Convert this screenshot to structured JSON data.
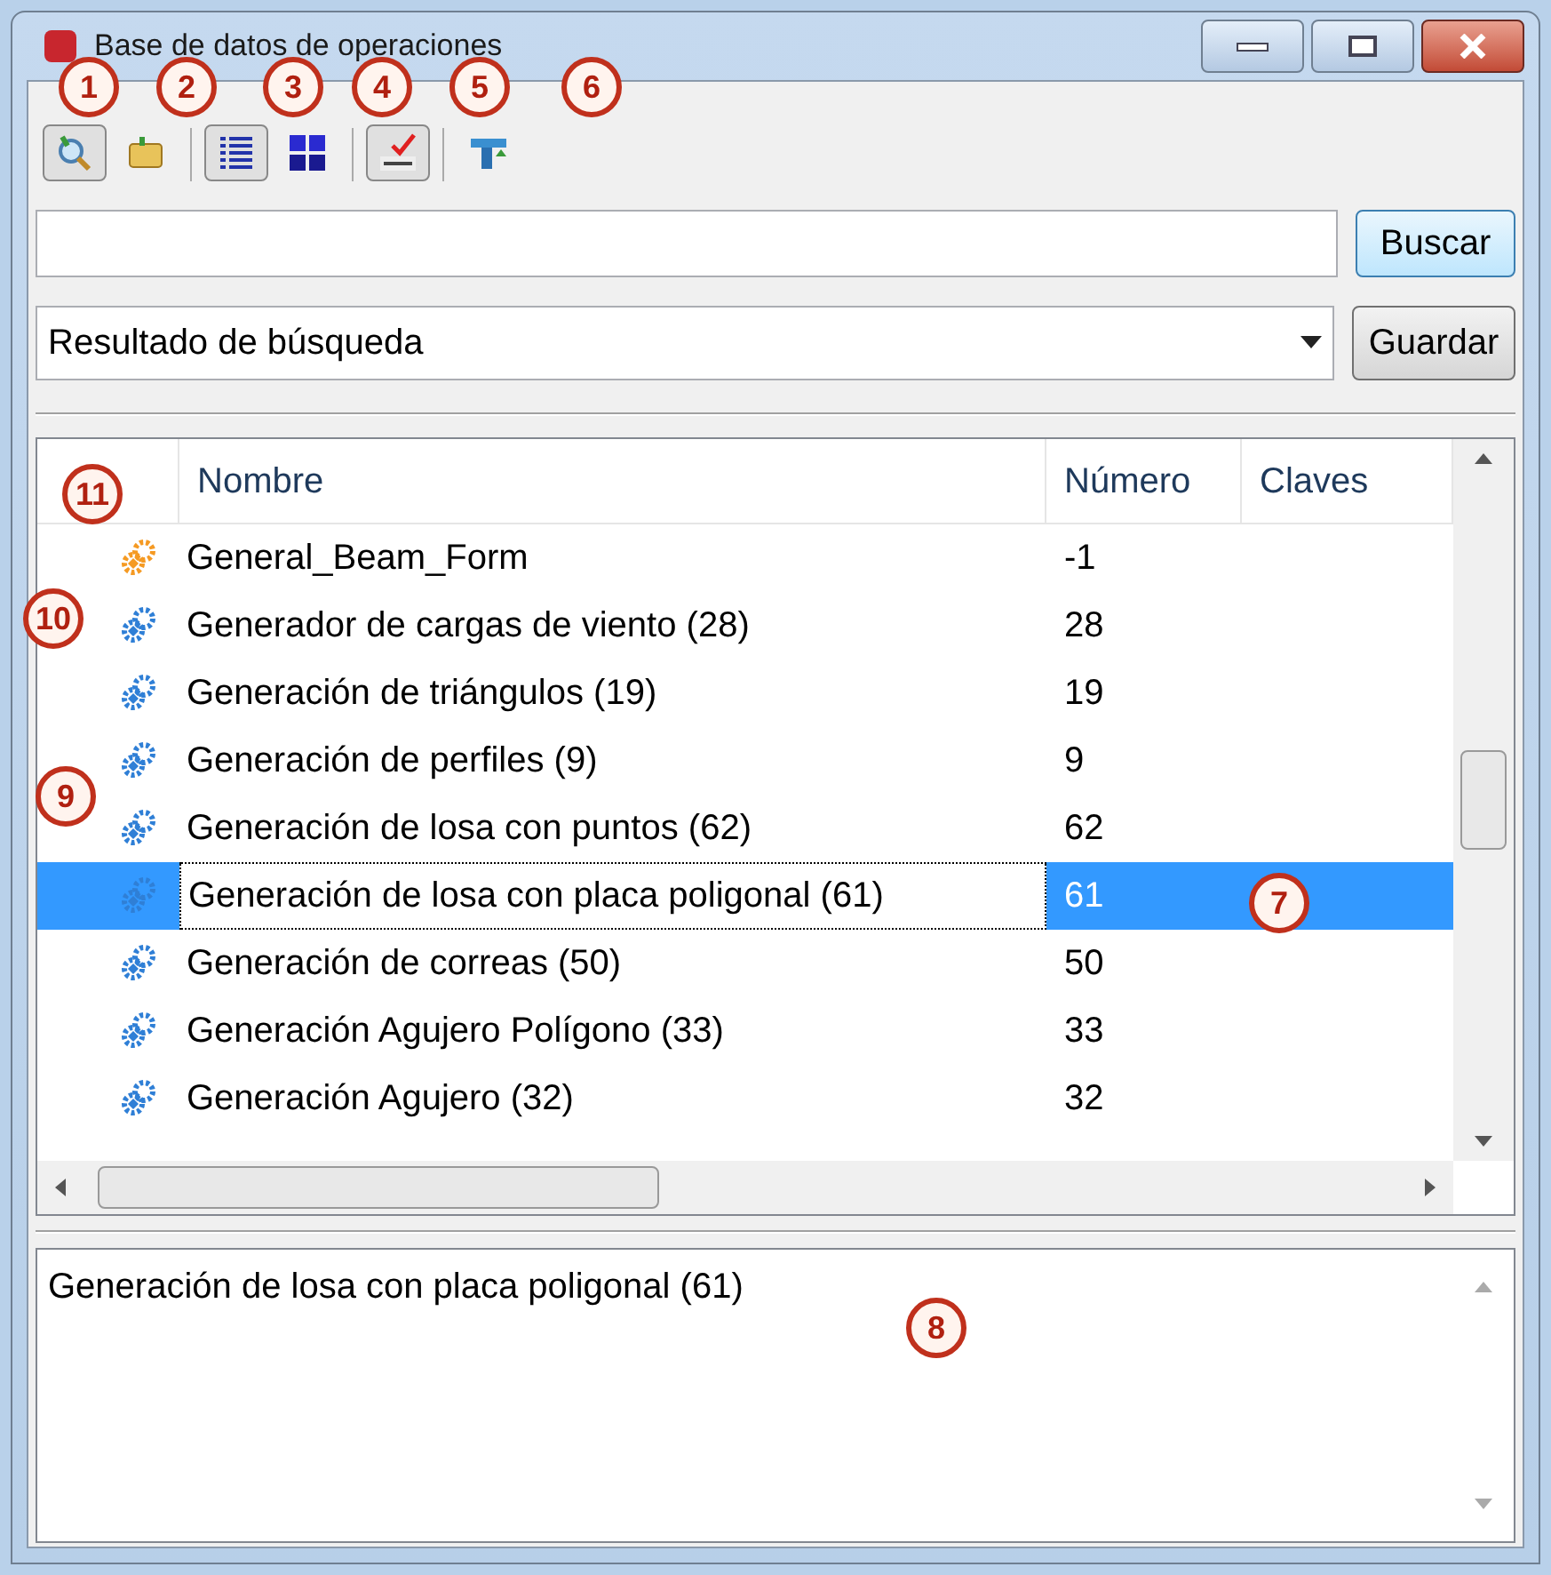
{
  "window": {
    "title": "Base de datos de operaciones"
  },
  "toolbar": [
    {
      "kind": "search",
      "pressed": true
    },
    {
      "kind": "folder",
      "pressed": false
    },
    {
      "kind": "list",
      "pressed": true
    },
    {
      "kind": "tiles",
      "pressed": false
    },
    {
      "kind": "spell",
      "pressed": true
    },
    {
      "kind": "filter",
      "pressed": false
    }
  ],
  "search": {
    "button": "Buscar"
  },
  "result_select": {
    "value": "Resultado de búsqueda",
    "button": "Guardar"
  },
  "table": {
    "columns": [
      "Nombre",
      "Número",
      "Claves"
    ],
    "rows": [
      {
        "name": "General_Beam_Form",
        "number": "-1",
        "color": "#f59a23",
        "selected": false
      },
      {
        "name": "Generador de cargas de viento (28)",
        "number": "28",
        "color": "#2f7fd6",
        "selected": false
      },
      {
        "name": "Generación de triángulos (19)",
        "number": "19",
        "color": "#2f7fd6",
        "selected": false
      },
      {
        "name": "Generación de perfiles (9)",
        "number": "9",
        "color": "#2f7fd6",
        "selected": false
      },
      {
        "name": "Generación de losa con puntos (62)",
        "number": "62",
        "color": "#2f7fd6",
        "selected": false
      },
      {
        "name": "Generación de losa con placa poligonal (61)",
        "number": "61",
        "color": "#2f7fd6",
        "selected": true
      },
      {
        "name": "Generación de correas (50)",
        "number": "50",
        "color": "#2f7fd6",
        "selected": false
      },
      {
        "name": "Generación Agujero Polígono (33)",
        "number": "33",
        "color": "#2f7fd6",
        "selected": false
      },
      {
        "name": "Generación Agujero (32)",
        "number": "32",
        "color": "#2f7fd6",
        "selected": false
      }
    ]
  },
  "description": "Generación de losa con placa poligonal (61)",
  "callouts": [
    "1",
    "2",
    "3",
    "4",
    "5",
    "6",
    "7",
    "8",
    "9",
    "10",
    "11"
  ]
}
